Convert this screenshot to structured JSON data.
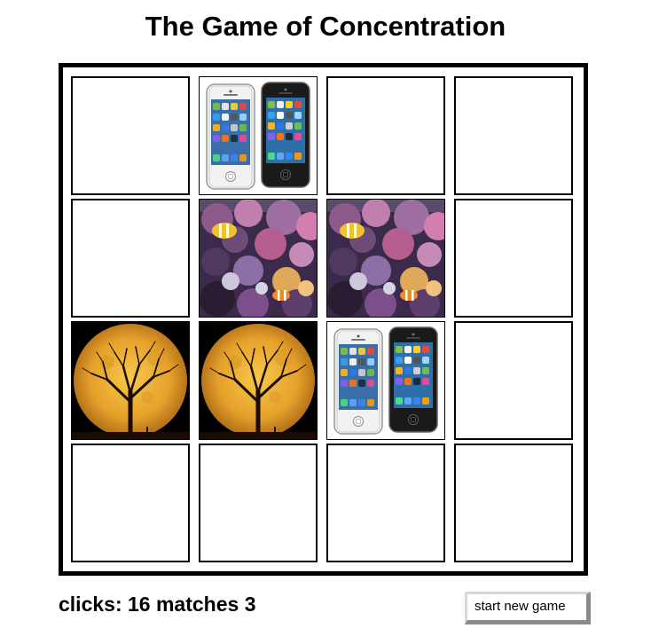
{
  "title": "The Game of Concentration",
  "board": {
    "rows": 4,
    "cols": 4,
    "cells": [
      {
        "index": 0,
        "state": "hidden",
        "image": ""
      },
      {
        "index": 1,
        "state": "revealed",
        "image": "iphone"
      },
      {
        "index": 2,
        "state": "hidden",
        "image": ""
      },
      {
        "index": 3,
        "state": "hidden",
        "image": ""
      },
      {
        "index": 4,
        "state": "hidden",
        "image": ""
      },
      {
        "index": 5,
        "state": "revealed",
        "image": "coral-reef"
      },
      {
        "index": 6,
        "state": "revealed",
        "image": "coral-reef"
      },
      {
        "index": 7,
        "state": "hidden",
        "image": ""
      },
      {
        "index": 8,
        "state": "revealed",
        "image": "full-moon-tree"
      },
      {
        "index": 9,
        "state": "revealed",
        "image": "full-moon-tree"
      },
      {
        "index": 10,
        "state": "revealed",
        "image": "iphone"
      },
      {
        "index": 11,
        "state": "hidden",
        "image": ""
      },
      {
        "index": 12,
        "state": "hidden",
        "image": ""
      },
      {
        "index": 13,
        "state": "hidden",
        "image": ""
      },
      {
        "index": 14,
        "state": "hidden",
        "image": ""
      },
      {
        "index": 15,
        "state": "hidden",
        "image": ""
      }
    ]
  },
  "status": {
    "clicks_label": "clicks:",
    "clicks": "16",
    "matches_label": "matches",
    "matches": "3"
  },
  "button": {
    "new_game_label": "start new game"
  }
}
